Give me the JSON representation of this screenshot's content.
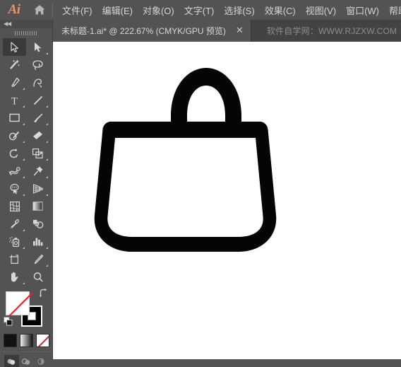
{
  "app": {
    "logo_text": "Ai",
    "home_icon": "home-icon"
  },
  "menubar": {
    "items": [
      {
        "label": "文件(F)",
        "name": "menu-file"
      },
      {
        "label": "编辑(E)",
        "name": "menu-edit"
      },
      {
        "label": "对象(O)",
        "name": "menu-object"
      },
      {
        "label": "文字(T)",
        "name": "menu-type"
      },
      {
        "label": "选择(S)",
        "name": "menu-select"
      },
      {
        "label": "效果(C)",
        "name": "menu-effect"
      },
      {
        "label": "视图(V)",
        "name": "menu-view"
      },
      {
        "label": "窗口(W)",
        "name": "menu-window"
      },
      {
        "label": "帮助(H",
        "name": "menu-help"
      }
    ]
  },
  "tabbar": {
    "document_title": "未标题-1.ai* @ 222.67% (CMYK/GPU 预览)",
    "close_glyph": "✕",
    "watermark": "软件自学网：WWW.RJZXW.COM"
  },
  "toolpanel": {
    "collapse_glyph": "◀◀",
    "tools": [
      {
        "label": "选择工具",
        "name": "tool-selection",
        "icon": "arrow-cursor-icon",
        "active": true,
        "corner": false
      },
      {
        "label": "直接选择工具",
        "name": "tool-direct-selection",
        "icon": "direct-select-icon",
        "active": false,
        "corner": true
      },
      {
        "label": "魔棒工具",
        "name": "tool-magic-wand",
        "icon": "magic-wand-icon",
        "active": false,
        "corner": false
      },
      {
        "label": "套索工具",
        "name": "tool-lasso",
        "icon": "lasso-icon",
        "active": false,
        "corner": false
      },
      {
        "label": "钢笔工具",
        "name": "tool-pen",
        "icon": "pen-icon",
        "active": false,
        "corner": true
      },
      {
        "label": "曲率工具",
        "name": "tool-curvature",
        "icon": "curvature-icon",
        "active": false,
        "corner": false
      },
      {
        "label": "文字工具",
        "name": "tool-type",
        "icon": "type-icon",
        "active": false,
        "corner": true
      },
      {
        "label": "直线段工具",
        "name": "tool-line",
        "icon": "line-icon",
        "active": false,
        "corner": true
      },
      {
        "label": "矩形工具",
        "name": "tool-rectangle",
        "icon": "rectangle-icon",
        "active": false,
        "corner": true
      },
      {
        "label": "画笔工具",
        "name": "tool-paintbrush",
        "icon": "paintbrush-icon",
        "active": false,
        "corner": true
      },
      {
        "label": "Shaper 工具",
        "name": "tool-shaper",
        "icon": "shaper-pencil-icon",
        "active": false,
        "corner": true
      },
      {
        "label": "橡皮擦工具",
        "name": "tool-eraser",
        "icon": "eraser-icon",
        "active": false,
        "corner": true
      },
      {
        "label": "旋转工具",
        "name": "tool-rotate",
        "icon": "rotate-icon",
        "active": false,
        "corner": true
      },
      {
        "label": "比例缩放工具",
        "name": "tool-scale",
        "icon": "scale-icon",
        "active": false,
        "corner": true
      },
      {
        "label": "宽度工具",
        "name": "tool-width",
        "icon": "width-warp-icon",
        "active": false,
        "corner": true
      },
      {
        "label": "自由变换工具",
        "name": "tool-free-transform",
        "icon": "pushpin-icon",
        "active": false,
        "corner": true
      },
      {
        "label": "形状生成器工具",
        "name": "tool-shape-builder",
        "icon": "shape-builder-icon",
        "active": false,
        "corner": true
      },
      {
        "label": "透视网格工具",
        "name": "tool-perspective-grid",
        "icon": "perspective-grid-icon",
        "active": false,
        "corner": true
      },
      {
        "label": "网格工具",
        "name": "tool-mesh",
        "icon": "mesh-icon",
        "active": false,
        "corner": false
      },
      {
        "label": "渐变工具",
        "name": "tool-gradient",
        "icon": "gradient-icon",
        "active": false,
        "corner": false
      },
      {
        "label": "吸管工具",
        "name": "tool-eyedropper",
        "icon": "eyedropper-icon",
        "active": false,
        "corner": true
      },
      {
        "label": "混合工具",
        "name": "tool-blend",
        "icon": "blend-icon",
        "active": false,
        "corner": false
      },
      {
        "label": "符号喷枪工具",
        "name": "tool-symbol-sprayer",
        "icon": "symbol-sprayer-icon",
        "active": false,
        "corner": true
      },
      {
        "label": "柱形图工具",
        "name": "tool-column-graph",
        "icon": "column-graph-icon",
        "active": false,
        "corner": true
      },
      {
        "label": "画板工具",
        "name": "tool-artboard",
        "icon": "artboard-icon",
        "active": false,
        "corner": false
      },
      {
        "label": "切片工具",
        "name": "tool-slice",
        "icon": "slice-knife-icon",
        "active": false,
        "corner": true
      },
      {
        "label": "抓手工具",
        "name": "tool-hand",
        "icon": "hand-icon",
        "active": false,
        "corner": true
      },
      {
        "label": "缩放工具",
        "name": "tool-zoom",
        "icon": "magnifier-icon",
        "active": false,
        "corner": false
      }
    ],
    "colors": {
      "fill_label": "填色",
      "fill_value": "无",
      "fill_color": "#ffffff",
      "stroke_label": "描边",
      "stroke_color": "#000000",
      "swap_label": "互换填色和描边",
      "default_label": "默认填色和描边"
    },
    "color_modes": [
      {
        "label": "颜色",
        "name": "color-mode-color"
      },
      {
        "label": "渐变",
        "name": "color-mode-gradient"
      },
      {
        "label": "无",
        "name": "color-mode-none"
      }
    ],
    "draw_modes": [
      {
        "label": "正常绘图",
        "name": "draw-mode-normal",
        "active": true
      },
      {
        "label": "背面绘图",
        "name": "draw-mode-behind",
        "active": false
      },
      {
        "label": "内部绘图",
        "name": "draw-mode-inside",
        "active": false
      }
    ]
  },
  "canvas": {
    "background": "#ffffff",
    "artwork_name": "handbag-outline-shape",
    "artwork_color": "#050505",
    "zoom_level": "222.67%"
  }
}
